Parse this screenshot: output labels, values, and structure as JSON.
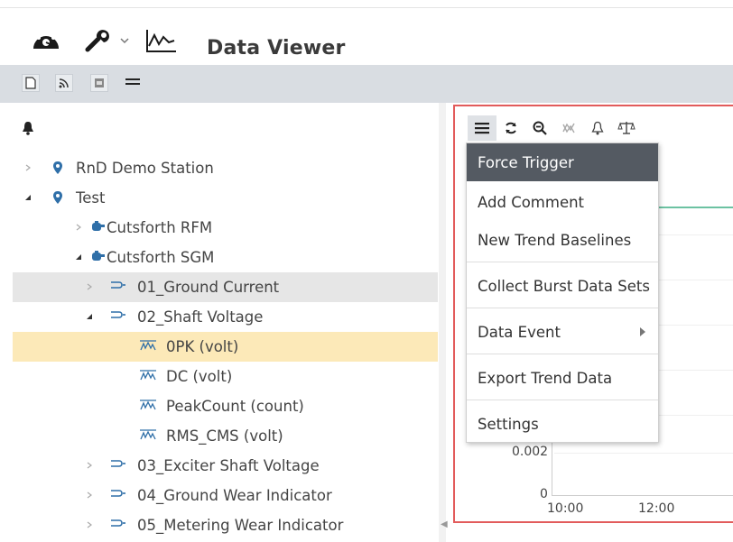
{
  "header": {
    "title": "Data Viewer",
    "icons": [
      "dashboard-icon",
      "wrench-icon",
      "chevron-down-icon",
      "trend-chart-icon"
    ]
  },
  "toolbar": {
    "buttons": [
      "new-page-icon",
      "rss-feed-icon",
      "panel-icon",
      "hamburger-menu-icon"
    ]
  },
  "tree": {
    "header_icon": "bell-icon",
    "items": [
      {
        "label": "RnD Demo Station",
        "level": 0,
        "expanded": false,
        "icon": "location-pin-icon"
      },
      {
        "label": "Test",
        "level": 0,
        "expanded": true,
        "icon": "location-pin-icon"
      },
      {
        "label": "Cutsforth RFM",
        "level": 1,
        "expanded": false,
        "icon": "device-icon"
      },
      {
        "label": "Cutsforth SGM",
        "level": 1,
        "expanded": true,
        "icon": "device-icon"
      },
      {
        "label": "01_Ground Current",
        "level": 2,
        "expanded": false,
        "icon": "channel-icon",
        "highlight": "hover"
      },
      {
        "label": "02_Shaft Voltage",
        "level": 2,
        "expanded": true,
        "icon": "channel-icon"
      },
      {
        "label": "0PK (volt)",
        "level": 3,
        "icon": "measurement-icon",
        "highlight": "selected"
      },
      {
        "label": "DC (volt)",
        "level": 3,
        "icon": "measurement-icon"
      },
      {
        "label": "PeakCount (count)",
        "level": 3,
        "icon": "measurement-icon"
      },
      {
        "label": "RMS_CMS (volt)",
        "level": 3,
        "icon": "measurement-icon"
      },
      {
        "label": "03_Exciter Shaft Voltage",
        "level": 2,
        "expanded": false,
        "icon": "channel-icon"
      },
      {
        "label": "04_Ground Wear Indicator",
        "level": 2,
        "expanded": false,
        "icon": "channel-icon"
      },
      {
        "label": "05_Metering Wear Indicator",
        "level": 2,
        "expanded": false,
        "icon": "channel-icon"
      }
    ]
  },
  "chart_toolbar": {
    "icons": [
      "menu-icon",
      "refresh-icon",
      "zoom-out-icon",
      "compare-icon",
      "bell-icon",
      "scale-icon"
    ]
  },
  "context_menu": {
    "items": [
      "Force Trigger",
      "Add Comment",
      "New Trend Baselines",
      "Collect Burst Data Sets",
      "Data Event",
      "Export Trend Data",
      "Settings"
    ],
    "active_item": "Force Trigger",
    "submenu_item": "Data Event"
  },
  "chart": {
    "y_ticks": [
      "0.002",
      "0"
    ],
    "x_ticks": [
      "10:00",
      "12:00"
    ],
    "colors": {
      "line": "#6cc2a2",
      "panel_border": "#e25b5b"
    }
  },
  "colors": {
    "toolbar_bg": "#d9dde2",
    "hover_bg": "#e6e6e6",
    "selected_bg": "#fce9b8",
    "menu_active_bg": "#545a62",
    "icon_blue": "#2f6fa8"
  }
}
